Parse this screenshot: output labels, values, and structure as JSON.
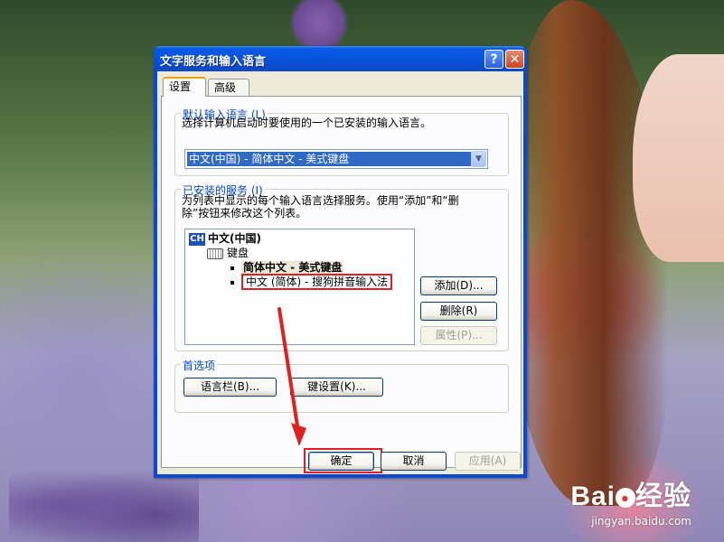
{
  "window": {
    "title": "文字服务和输入语言",
    "help_icon": "help-icon",
    "close_icon": "close-icon"
  },
  "tabs": [
    {
      "label": "设置",
      "active": true
    },
    {
      "label": "高级",
      "active": false
    }
  ],
  "default_language": {
    "group_label": "默认输入语言 (L)",
    "description": "选择计算机启动时要使用的一个已安装的输入语言。",
    "selected": "中文(中国) - 简体中文 - 美式键盘"
  },
  "installed_services": {
    "group_label": "已安装的服务 (I)",
    "description_line1": "为列表中显示的每个输入语言选择服务。使用“添加”和“删",
    "description_line2": "除”按钮来修改这个列表。",
    "tree": {
      "language_badge": "CH",
      "language": "中文(中国)",
      "category": "键盘",
      "items": [
        "简体中文 - 美式键盘",
        "中文 (简体) - 搜狗拼音输入法"
      ]
    },
    "buttons": {
      "add": "添加(D)...",
      "remove": "删除(R)",
      "properties": "属性(P)..."
    }
  },
  "preferences": {
    "group_label": "首选项",
    "language_bar": "语言栏(B)...",
    "key_settings": "键设置(K)..."
  },
  "footer": {
    "ok": "确定",
    "cancel": "取消",
    "apply": "应用(A)"
  },
  "watermark": {
    "logo": "Bai",
    "logo_suffix": "经验",
    "url": "jingyan.baidu.com"
  },
  "colors": {
    "titlebar": "#0a5ae6",
    "selection": "#316ac5",
    "group_label": "#0046d5",
    "annotation": "#e02020"
  }
}
